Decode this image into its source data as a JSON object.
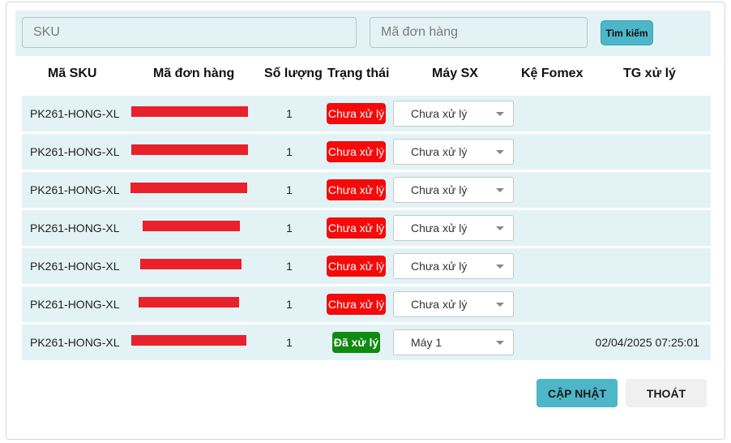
{
  "search": {
    "sku_placeholder": "SKU",
    "order_placeholder": "Mã đơn hàng",
    "search_label": "Tìm kiếm"
  },
  "table": {
    "columns": [
      "Mã SKU",
      "Mã đơn hàng",
      "Số lượng",
      "Trạng thái",
      "Máy SX",
      "Kệ Fomex",
      "TG xử lý"
    ],
    "rows": [
      {
        "sku": "PK261-HONG-XL",
        "qty": "1",
        "status": "Chưa xử lý",
        "status_color": "#f50a0a",
        "machine": "Chưa xử lý",
        "shelf": "",
        "time": ""
      },
      {
        "sku": "PK261-HONG-XL",
        "qty": "1",
        "status": "Chưa xử lý",
        "status_color": "#f50a0a",
        "machine": "Chưa xử lý",
        "shelf": "",
        "time": ""
      },
      {
        "sku": "PK261-HONG-XL",
        "qty": "1",
        "status": "Chưa xử lý",
        "status_color": "#f50a0a",
        "machine": "Chưa xử lý",
        "shelf": "",
        "time": ""
      },
      {
        "sku": "PK261-HONG-XL",
        "qty": "1",
        "status": "Chưa xử lý",
        "status_color": "#f50a0a",
        "machine": "Chưa xử lý",
        "shelf": "",
        "time": ""
      },
      {
        "sku": "PK261-HONG-XL",
        "qty": "1",
        "status": "Chưa xử lý",
        "status_color": "#f50a0a",
        "machine": "Chưa xử lý",
        "shelf": "",
        "time": ""
      },
      {
        "sku": "PK261-HONG-XL",
        "qty": "1",
        "status": "Chưa xử lý",
        "status_color": "#f50a0a",
        "machine": "Chưa xử lý",
        "shelf": "",
        "time": ""
      },
      {
        "sku": "PK261-HONG-XL",
        "qty": "1",
        "status": "Đã xử lý",
        "status_color": "#108a10",
        "machine": "Máy 1",
        "shelf": "",
        "time": "02/04/2025 07:25:01"
      }
    ]
  },
  "actions": {
    "update_label": "CẬP NHẬT",
    "exit_label": "THOÁT"
  },
  "colors": {
    "accent": "#4db6c9",
    "row_bg": "#e3f3f5",
    "redaction": "#e8212d"
  }
}
